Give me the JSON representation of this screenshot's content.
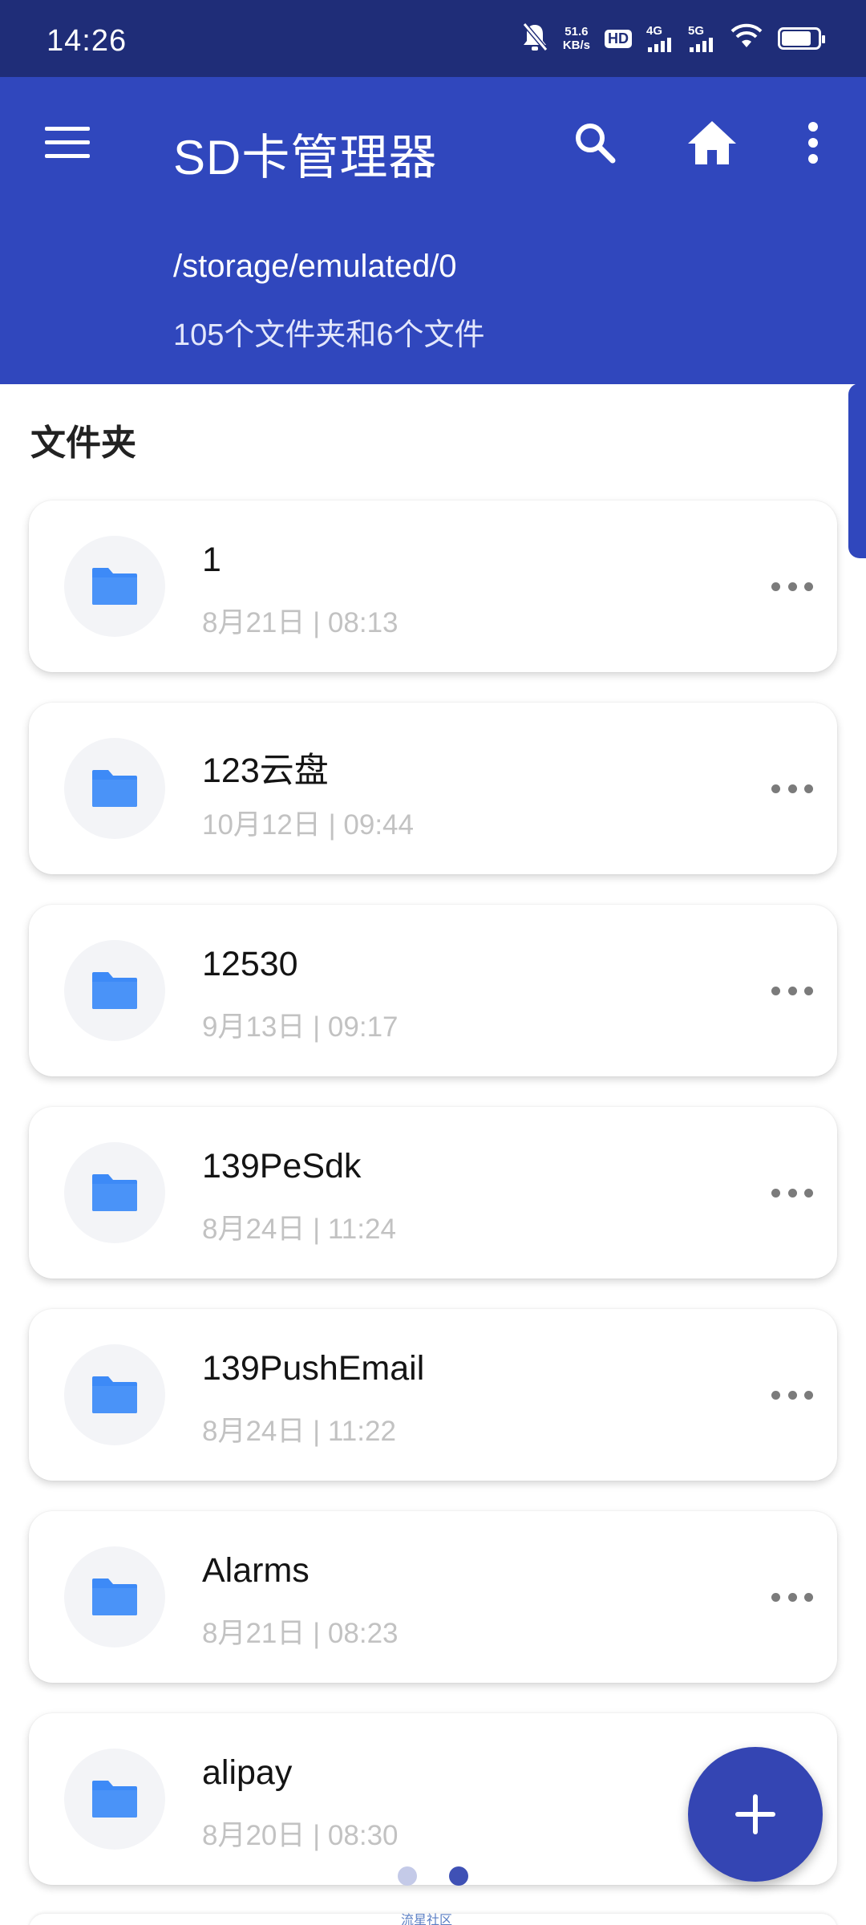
{
  "status_bar": {
    "time": "14:26",
    "net_speed_value": "51.6",
    "net_speed_unit": "KB/s",
    "hd_label": "HD",
    "signal_1": "4G",
    "signal_2": "5G",
    "icons": [
      "mute-bell-icon",
      "hd-voice-icon",
      "signal-4g-icon",
      "signal-5g-icon",
      "wifi-icon",
      "battery-icon"
    ]
  },
  "header": {
    "title": "SD卡管理器",
    "path": "/storage/emulated/0",
    "summary": "105个文件夹和6个文件",
    "icons": [
      "menu-icon",
      "search-icon",
      "home-icon",
      "more-vert-icon"
    ]
  },
  "section": {
    "title": "文件夹"
  },
  "folders": [
    {
      "name": "1",
      "date": "8月21日 | 08:13"
    },
    {
      "name": "123云盘",
      "date": "10月12日 | 09:44"
    },
    {
      "name": "12530",
      "date": "9月13日 | 09:17"
    },
    {
      "name": "139PeSdk",
      "date": "8月24日 | 11:24"
    },
    {
      "name": "139PushEmail",
      "date": "8月24日 | 11:22"
    },
    {
      "name": "Alarms",
      "date": "8月21日 | 08:23"
    },
    {
      "name": "alipay",
      "date": "8月20日 | 08:30"
    }
  ],
  "pager": {
    "page_count": 2,
    "active_page": 2
  },
  "watermark": "流星社区",
  "colors": {
    "status_bar": "#1f2d78",
    "header": "#3047bd",
    "fab": "#3445b3",
    "folder_icon": "#3d8af7",
    "date_text": "#c2c2c2"
  }
}
